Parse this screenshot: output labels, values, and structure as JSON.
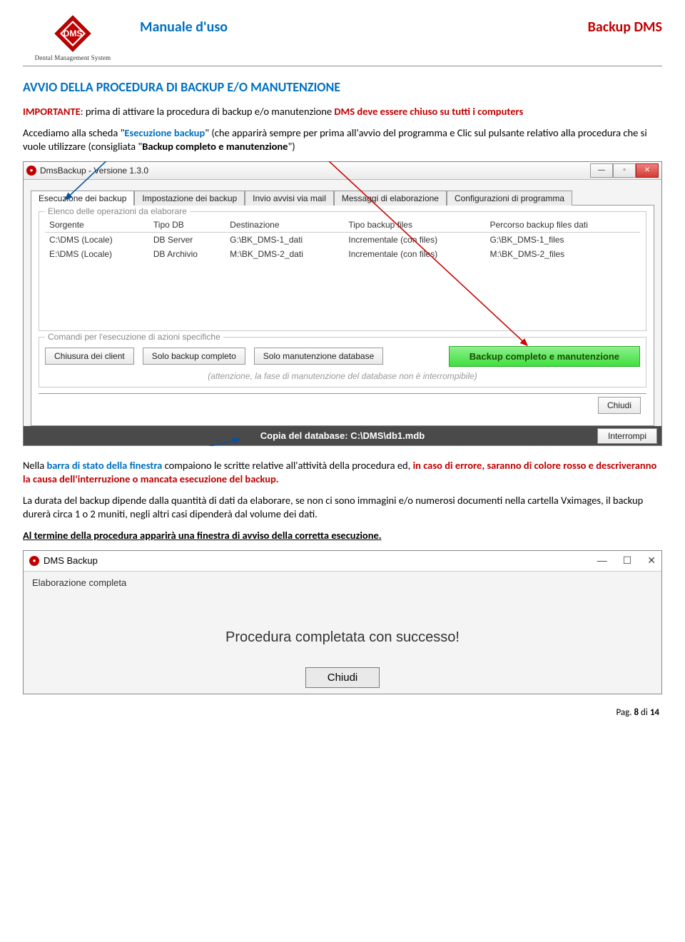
{
  "logo": {
    "text": "DMS",
    "caption": "Dental Management System"
  },
  "header": {
    "left": "Manuale d'uso",
    "right": "Backup DMS"
  },
  "section_heading": "AVVIO DELLA PROCEDURA DI BACKUP E/O MANUTENZIONE",
  "para1": {
    "p1a": "IMPORTANTE",
    "p1b": ": prima di attivare la procedura di backup e/o manutenzione ",
    "p1c": "DMS deve essere chiuso su tutti i computers"
  },
  "para2": {
    "a": "Accediamo alla scheda \"",
    "b": "Esecuzione backup",
    "c": "\" (che apparirà sempre per prima all'avvio del programma e Clic sul pulsante relativo alla procedura che si vuole utilizzare (consigliata \"",
    "d": "Backup completo e manutenzione",
    "e": "\")"
  },
  "screenshot1": {
    "title": "DmsBackup - Versione 1.3.0",
    "win_min": "—",
    "win_max": "▫",
    "win_close": "✕",
    "tabs": [
      "Esecuzione dei backup",
      "Impostazione dei backup",
      "Invio avvisi via mail",
      "Messaggi di elaborazione",
      "Configurazioni di programma"
    ],
    "group1_title": "Elenco delle operazioni da elaborare",
    "cols": [
      "Sorgente",
      "Tipo DB",
      "Destinazione",
      "Tipo backup files",
      "Percorso backup files dati"
    ],
    "rows": [
      [
        "C:\\DMS (Locale)",
        "DB Server",
        "G:\\BK_DMS-1_dati",
        "Incrementale (con files)",
        "G:\\BK_DMS-1_files"
      ],
      [
        "E:\\DMS (Locale)",
        "DB Archivio",
        "M:\\BK_DMS-2_dati",
        "Incrementale (con files)",
        "M:\\BK_DMS-2_files"
      ]
    ],
    "group2_title": "Comandi per l'esecuzione di azioni specifiche",
    "btn_chiusura": "Chiusura dei client",
    "btn_solo_backup": "Solo backup completo",
    "btn_solo_manut": "Solo manutenzione database",
    "btn_green": "Backup completo e manutenzione",
    "note": "(attenzione, la fase di manutenzione del database non è interrompibile)",
    "btn_chiudi": "Chiudi",
    "status": "Copia del database: C:\\DMS\\db1.mdb",
    "btn_interrompi": "Interrompi"
  },
  "para3": {
    "a": "Nella ",
    "b": "barra di stato della finestra",
    "c": " compaiono le scritte relative all'attività della procedura ed, ",
    "d": "in caso di errore, saranno di colore rosso e descriveranno la causa dell'interruzione o mancata esecuzione del backup.",
    "e": ""
  },
  "para4": "La durata del backup dipende dalla quantità di dati da elaborare, se non ci sono immagini e/o numerosi documenti nella cartella Vximages, il backup durerà circa 1 o 2 muniti, negli altri casi dipenderà dal volume dei dati.",
  "para5": "Al termine della procedura apparirà una finestra di avviso della corretta esecuzione.",
  "screenshot2": {
    "title": "DMS Backup",
    "elab": "Elaborazione completa",
    "success": "Procedura completata con successo!",
    "chiudi": "Chiudi",
    "min": "—",
    "max": "☐",
    "close": "✕"
  },
  "footer": {
    "a": "Pag. ",
    "b": "8",
    "c": " di ",
    "d": "14"
  }
}
